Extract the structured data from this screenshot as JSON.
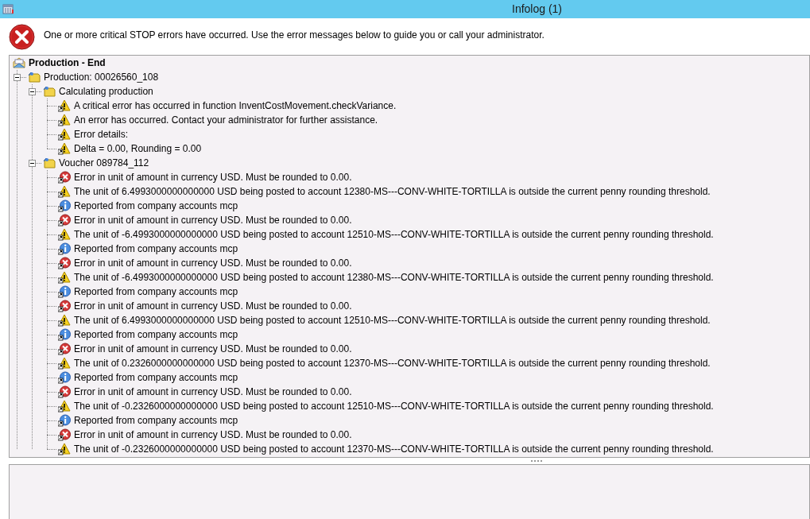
{
  "window": {
    "title": "Infolog (1)"
  },
  "header": {
    "message": "One or more critical STOP errors have occurred. Use the error messages below to guide you or call your administrator."
  },
  "tree": [
    {
      "kind": "root",
      "label": "Production - End",
      "children": [
        {
          "kind": "folder",
          "label": "Production: 00026560_108",
          "expanded": true,
          "children": [
            {
              "kind": "folder",
              "label": "Calculating production",
              "expanded": true,
              "children": [
                {
                  "kind": "warning",
                  "label": "A critical error has occurred in function InventCostMovement.checkVariance."
                },
                {
                  "kind": "warning",
                  "label": "An error has occurred. Contact your administrator for further assistance."
                },
                {
                  "kind": "warning",
                  "label": "Error details:"
                },
                {
                  "kind": "warning",
                  "label": "Delta = 0.00, Rounding = 0.00"
                }
              ]
            },
            {
              "kind": "folder",
              "label": "Voucher 089784_112",
              "expanded": true,
              "children": [
                {
                  "kind": "error",
                  "label": "Error in unit of amount in currency USD. Must be rounded to 0.00."
                },
                {
                  "kind": "warning",
                  "label": "The unit of 6.4993000000000000 USD being posted to account 12380-MS---CONV-WHITE-TORTILLA is outside the current penny rounding threshold."
                },
                {
                  "kind": "info",
                  "label": "Reported from company accounts mcp"
                },
                {
                  "kind": "error",
                  "label": "Error in unit of amount in currency USD. Must be rounded to 0.00."
                },
                {
                  "kind": "warning",
                  "label": "The unit of -6.4993000000000000 USD being posted to account 12510-MS---CONV-WHITE-TORTILLA is outside the current penny rounding threshold."
                },
                {
                  "kind": "info",
                  "label": "Reported from company accounts mcp"
                },
                {
                  "kind": "error",
                  "label": "Error in unit of amount in currency USD. Must be rounded to 0.00."
                },
                {
                  "kind": "warning",
                  "label": "The unit of -6.4993000000000000 USD being posted to account 12380-MS---CONV-WHITE-TORTILLA is outside the current penny rounding threshold."
                },
                {
                  "kind": "info",
                  "label": "Reported from company accounts mcp"
                },
                {
                  "kind": "error",
                  "label": "Error in unit of amount in currency USD. Must be rounded to 0.00."
                },
                {
                  "kind": "warning",
                  "label": "The unit of 6.4993000000000000 USD being posted to account 12510-MS---CONV-WHITE-TORTILLA is outside the current penny rounding threshold."
                },
                {
                  "kind": "info",
                  "label": "Reported from company accounts mcp"
                },
                {
                  "kind": "error",
                  "label": "Error in unit of amount in currency USD. Must be rounded to 0.00."
                },
                {
                  "kind": "warning",
                  "label": "The unit of 0.2326000000000000 USD being posted to account 12370-MS---CONV-WHITE-TORTILLA is outside the current penny rounding threshold."
                },
                {
                  "kind": "info",
                  "label": "Reported from company accounts mcp"
                },
                {
                  "kind": "error",
                  "label": "Error in unit of amount in currency USD. Must be rounded to 0.00."
                },
                {
                  "kind": "warning",
                  "label": "The unit of -0.2326000000000000 USD being posted to account 12510-MS---CONV-WHITE-TORTILLA is outside the current penny rounding threshold."
                },
                {
                  "kind": "info",
                  "label": "Reported from company accounts mcp"
                },
                {
                  "kind": "error",
                  "label": "Error in unit of amount in currency USD. Must be rounded to 0.00."
                },
                {
                  "kind": "warning",
                  "label": "The unit of -0.2326000000000000 USD being posted to account 12370-MS---CONV-WHITE-TORTILLA is outside the current penny rounding threshold."
                }
              ]
            }
          ]
        }
      ]
    }
  ]
}
